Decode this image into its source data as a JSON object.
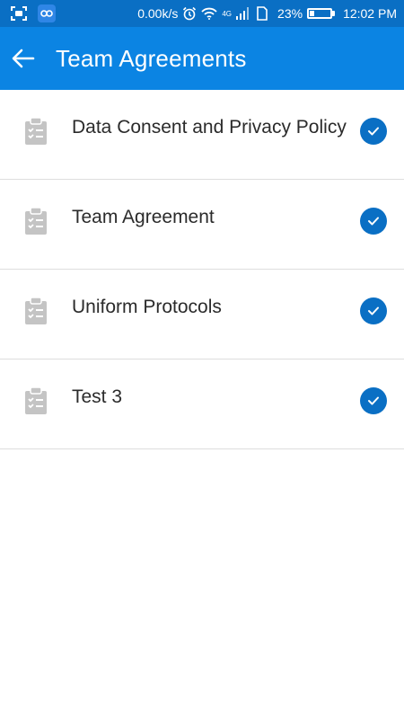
{
  "status_bar": {
    "network_speed": "0.00k/s",
    "network_type": "4G",
    "battery_percent": "23%",
    "battery_level": 0.23,
    "time": "12:02 PM",
    "icons": [
      "screenshot-icon",
      "app-icon",
      "alarm-icon",
      "wifi-icon",
      "signal-icon",
      "sim-icon",
      "battery-icon"
    ]
  },
  "header": {
    "title": "Team Agreements",
    "back_icon": "arrow-left-icon"
  },
  "agreements": [
    {
      "label": "Data Consent and Privacy Policy",
      "icon": "clipboard-check-icon",
      "status": "checked"
    },
    {
      "label": "Team Agreement",
      "icon": "clipboard-check-icon",
      "status": "checked"
    },
    {
      "label": "Uniform Protocols",
      "icon": "clipboard-check-icon",
      "status": "checked"
    },
    {
      "label": "Test 3",
      "icon": "clipboard-check-icon",
      "status": "checked"
    }
  ],
  "colors": {
    "status_bar": "#0a6fc4",
    "app_bar": "#0b84e3",
    "check_badge": "#0a6fc4",
    "divider": "#dedede",
    "item_icon": "#c4c4c4"
  }
}
